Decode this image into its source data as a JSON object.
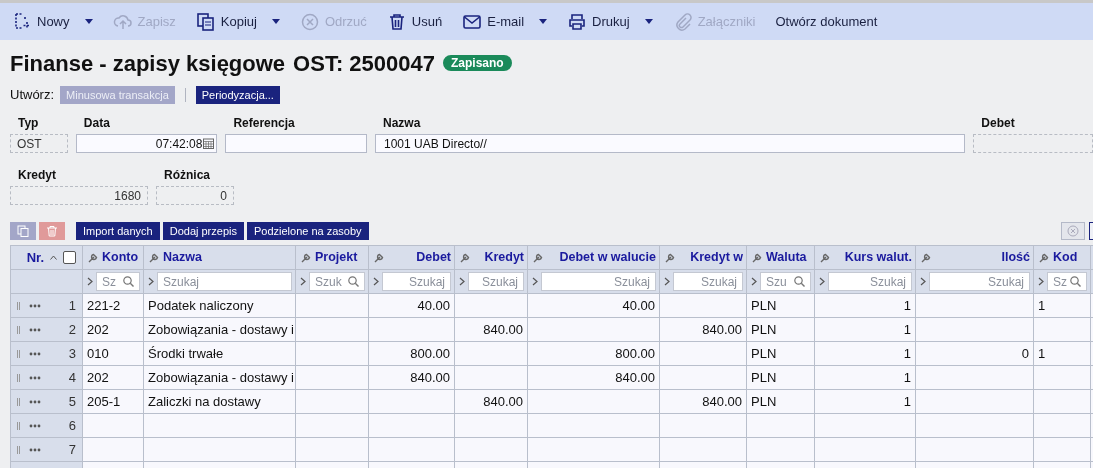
{
  "toolbar": [
    {
      "label": "Nowy",
      "kind": "new",
      "disabled": false,
      "dropdown": true
    },
    {
      "label": "Zapisz",
      "kind": "save",
      "disabled": true,
      "dropdown": false
    },
    {
      "label": "Kopiuj",
      "kind": "copy",
      "disabled": false,
      "dropdown": true
    },
    {
      "label": "Odrzuć",
      "kind": "discard",
      "disabled": true,
      "dropdown": false
    },
    {
      "label": "Usuń",
      "kind": "delete",
      "disabled": false,
      "dropdown": false
    },
    {
      "label": "E-mail",
      "kind": "email",
      "disabled": false,
      "dropdown": true
    },
    {
      "label": "Drukuj",
      "kind": "print",
      "disabled": false,
      "dropdown": true
    },
    {
      "label": "Załączniki",
      "kind": "attachments",
      "disabled": true,
      "dropdown": false
    },
    {
      "label": "Otwórz dokument",
      "kind": "text",
      "disabled": false,
      "dropdown": false
    }
  ],
  "title": "Finanse - zapisy księgowe",
  "doc_number": "OST: 2500047",
  "status": "Zapisano",
  "create": {
    "label": "Utwórz:",
    "buttons": [
      {
        "label": "Minusowa transakcja",
        "disabled": true
      },
      {
        "label": "Periodyzacja...",
        "disabled": false
      }
    ]
  },
  "fields": [
    {
      "label": "Typ",
      "value": "OST",
      "kind": "readonly"
    },
    {
      "label": "Data",
      "value": "07:42:08",
      "kind": "date"
    },
    {
      "label": "Referencja",
      "kind": "input"
    },
    {
      "label": "Nazwa",
      "value": "1001 UAB Directo//",
      "kind": "input"
    },
    {
      "label": "Debet",
      "kind": "readonly"
    }
  ],
  "totals": [
    {
      "label": "Kredyt",
      "value": "1680",
      "kind": "readonly"
    },
    {
      "label": "Różnica",
      "value": "0",
      "kind": "readonly"
    }
  ],
  "grid_buttons": [
    {
      "label": "Import danych"
    },
    {
      "label": "Dodaj przepis"
    },
    {
      "label": "Podzielone na zasoby"
    }
  ],
  "table": {
    "header_checkbox": {
      "checked": false
    },
    "nr_label": "Nr.",
    "columns": [
      {
        "label": "Konto",
        "kind": "text",
        "placeholder": "Sz",
        "search_icon": true
      },
      {
        "label": "Nazwa",
        "kind": "text",
        "placeholder": "Szukaj",
        "search_icon": false
      },
      {
        "label": "Projekt",
        "kind": "text",
        "placeholder": "Szuk",
        "search_icon": true
      },
      {
        "label": "Debet",
        "kind": "number",
        "placeholder": "Szukaj",
        "search_icon": false
      },
      {
        "label": "Kredyt",
        "kind": "number",
        "placeholder": "Szukaj",
        "search_icon": false
      },
      {
        "label": "Debet w walucie",
        "kind": "number",
        "placeholder": "Szukaj",
        "search_icon": false
      },
      {
        "label": "Kredyt w",
        "kind": "number",
        "placeholder": "Szukaj",
        "search_icon": false
      },
      {
        "label": "Waluta",
        "kind": "text",
        "placeholder": "Szu",
        "search_icon": true
      },
      {
        "label": "Kurs walut.",
        "kind": "number",
        "placeholder": "Szukaj",
        "search_icon": false
      },
      {
        "label": "Ilość",
        "kind": "number",
        "placeholder": "Szukaj",
        "search_icon": false
      },
      {
        "label": "Kod",
        "kind": "text",
        "placeholder": "Sz",
        "search_icon": true
      }
    ],
    "rows": [
      {
        "nr": "1",
        "cells": [
          "221-2",
          "Podatek naliczony",
          null,
          "40.00",
          null,
          "40.00",
          null,
          "PLN",
          "1",
          null,
          "1"
        ]
      },
      {
        "nr": "2",
        "cells": [
          "202",
          "Zobowiązania - dostawy i",
          null,
          null,
          "840.00",
          null,
          "840.00",
          "PLN",
          "1",
          null,
          null
        ]
      },
      {
        "nr": "3",
        "cells": [
          "010",
          "Środki trwałe",
          null,
          "800.00",
          null,
          "800.00",
          null,
          "PLN",
          "1",
          "0",
          "1"
        ]
      },
      {
        "nr": "4",
        "cells": [
          "202",
          "Zobowiązania - dostawy i",
          null,
          "840.00",
          null,
          "840.00",
          null,
          "PLN",
          "1",
          null,
          null
        ]
      },
      {
        "nr": "5",
        "cells": [
          "205-1",
          "Zaliczki na dostawy",
          null,
          null,
          "840.00",
          null,
          "840.00",
          "PLN",
          "1",
          null,
          null
        ]
      },
      {
        "nr": "6",
        "cells": [
          null,
          null,
          null,
          null,
          null,
          null,
          null,
          null,
          null,
          null,
          null
        ]
      },
      {
        "nr": "7",
        "cells": [
          null,
          null,
          null,
          null,
          null,
          null,
          null,
          null,
          null,
          null,
          null
        ]
      }
    ]
  }
}
